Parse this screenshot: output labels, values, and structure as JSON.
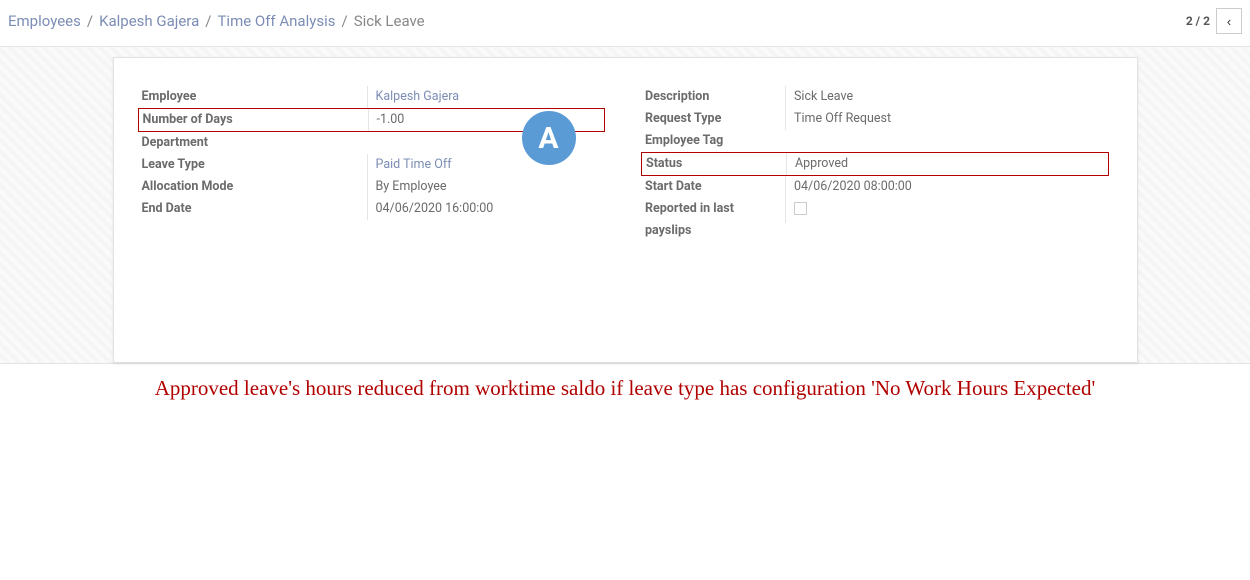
{
  "breadcrumb": {
    "employees": "Employees",
    "person": "Kalpesh Gajera",
    "analysis": "Time Off Analysis",
    "current": "Sick Leave"
  },
  "pager": {
    "label": "2 / 2",
    "prev_icon": "‹"
  },
  "badge": "A",
  "left": {
    "employee_label": "Employee",
    "employee_value": "Kalpesh Gajera",
    "numdays_label": "Number of Days",
    "numdays_value": "-1.00",
    "department_label": "Department",
    "department_value": "",
    "leavetype_label": "Leave Type",
    "leavetype_value": "Paid Time Off",
    "allocmode_label": "Allocation Mode",
    "allocmode_value": "By Employee",
    "enddate_label": "End Date",
    "enddate_value": "04/06/2020 16:00:00"
  },
  "right": {
    "description_label": "Description",
    "description_value": "Sick Leave",
    "reqtype_label": "Request Type",
    "reqtype_value": "Time Off Request",
    "emptag_label": "Employee Tag",
    "emptag_value": "",
    "status_label": "Status",
    "status_value": "Approved",
    "startdate_label": "Start Date",
    "startdate_value": "04/06/2020 08:00:00",
    "reported_label": "Reported in last payslips",
    "reported_value": ""
  },
  "caption": "Approved leave's hours reduced from worktime saldo if leave type has configuration 'No Work Hours Expected'"
}
